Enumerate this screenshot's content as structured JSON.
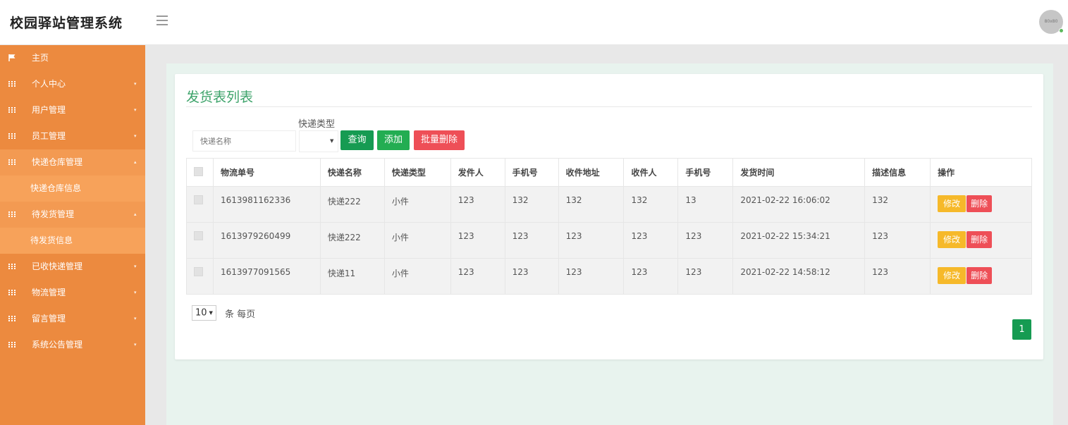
{
  "app": {
    "title": "校园驿站管理系统",
    "avatar_text": "80x80"
  },
  "sidebar": {
    "items": [
      {
        "label": "主页",
        "icon": "flag-icon"
      },
      {
        "label": "个人中心",
        "icon": "grid-icon"
      },
      {
        "label": "用户管理",
        "icon": "grid-icon"
      },
      {
        "label": "员工管理",
        "icon": "grid-icon"
      },
      {
        "label": "快递仓库管理",
        "icon": "grid-icon",
        "sub": "快递仓库信息"
      },
      {
        "label": "待发货管理",
        "icon": "grid-icon",
        "sub": "待发货信息"
      },
      {
        "label": "已收快递管理",
        "icon": "grid-icon"
      },
      {
        "label": "物流管理",
        "icon": "grid-icon"
      },
      {
        "label": "留言管理",
        "icon": "grid-icon"
      },
      {
        "label": "系统公告管理",
        "icon": "grid-icon"
      }
    ]
  },
  "main": {
    "title": "发货表列表",
    "search": {
      "name_placeholder": "快递名称",
      "type_label": "快递类型",
      "type_value": ""
    },
    "buttons": {
      "search": "查询",
      "add": "添加",
      "batch_delete": "批量删除"
    },
    "table": {
      "columns": [
        "物流单号",
        "快递名称",
        "快递类型",
        "发件人",
        "手机号",
        "收件地址",
        "收件人",
        "手机号",
        "发货时间",
        "描述信息",
        "操作"
      ],
      "rows": [
        [
          "1613981162336",
          "快递222",
          "小件",
          "123",
          "132",
          "132",
          "132",
          "13",
          "2021-02-22 16:06:02",
          "132"
        ],
        [
          "1613979260499",
          "快递222",
          "小件",
          "123",
          "123",
          "123",
          "123",
          "123",
          "2021-02-22 15:34:21",
          "123"
        ],
        [
          "1613977091565",
          "快递11",
          "小件",
          "123",
          "123",
          "123",
          "123",
          "123",
          "2021-02-22 14:58:12",
          "123"
        ]
      ],
      "edit_label": "修改",
      "delete_label": "删除"
    },
    "pager": {
      "size": "10",
      "size_suffix": "条 每页",
      "current_page": "1"
    }
  },
  "colors": {
    "sidebar": "#ec8a3f",
    "primary_green": "#169b52",
    "danger": "#ee4f57",
    "warning": "#f6b92a"
  }
}
